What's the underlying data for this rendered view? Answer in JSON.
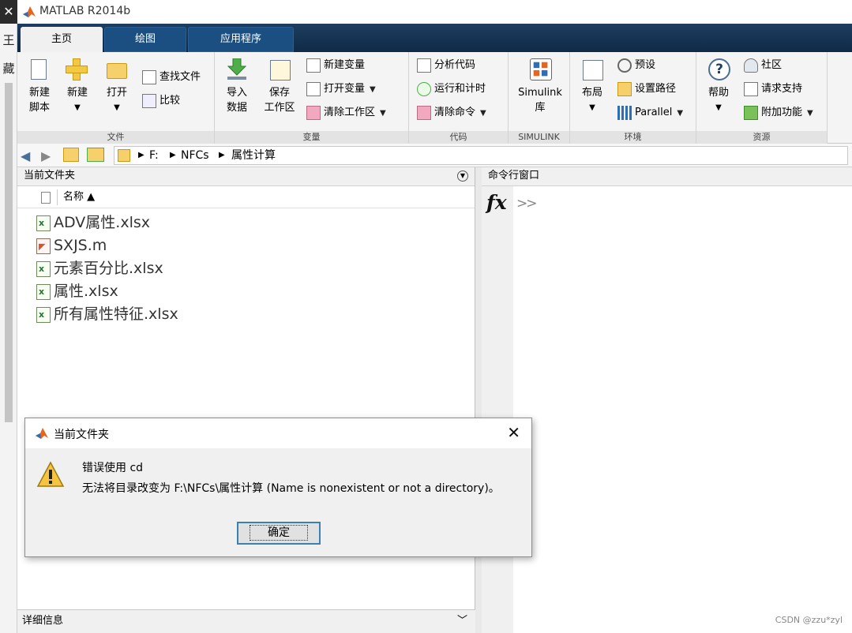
{
  "window": {
    "title": "MATLAB R2014b"
  },
  "left_strip": {
    "chars": [
      "王",
      "藏"
    ]
  },
  "tabs": [
    {
      "label": "主页",
      "active": true
    },
    {
      "label": "绘图",
      "active": false
    },
    {
      "label": "应用程序",
      "active": false
    }
  ],
  "ribbon": {
    "file": {
      "caption": "文件",
      "new_script": "新建\n脚本",
      "new": "新建",
      "open": "打开",
      "find_files": "查找文件",
      "compare": "比较"
    },
    "variable": {
      "caption": "变量",
      "import": "导入\n数据",
      "save_ws": "保存\n工作区",
      "new_var": "新建变量",
      "open_var": "打开变量",
      "clear_ws": "清除工作区"
    },
    "code": {
      "caption": "代码",
      "analyze": "分析代码",
      "run_time": "运行和计时",
      "clear_cmd": "清除命令"
    },
    "simulink": {
      "caption": "SIMULINK",
      "lib": "Simulink\n库"
    },
    "env": {
      "caption": "环境",
      "layout": "布局",
      "prefs": "预设",
      "set_path": "设置路径",
      "parallel": "Parallel"
    },
    "resources": {
      "caption": "资源",
      "help": "帮助",
      "community": "社区",
      "support": "请求支持",
      "addons": "附加功能"
    }
  },
  "address": {
    "segments": [
      "F:",
      "NFCs",
      "属性计算"
    ]
  },
  "file_panel": {
    "title": "当前文件夹",
    "column": "名称 ▲",
    "files": [
      {
        "name": "ADV属性.xlsx",
        "type": "xls"
      },
      {
        "name": "SXJS.m",
        "type": "m"
      },
      {
        "name": "元素百分比.xlsx",
        "type": "xls"
      },
      {
        "name": "属性.xlsx",
        "type": "xls"
      },
      {
        "name": "所有属性特征.xlsx",
        "type": "xls"
      }
    ],
    "details": "详细信息"
  },
  "cmd_panel": {
    "title": "命令行窗口",
    "fx": "fx",
    "prompt": ">>"
  },
  "dialog": {
    "title": "当前文件夹",
    "line1": "错误使用 cd",
    "line2": "无法将目录改变为 F:\\NFCs\\属性计算 (Name is nonexistent or not a directory)。",
    "ok": "确定"
  },
  "watermark": "CSDN @zzu*zyl"
}
